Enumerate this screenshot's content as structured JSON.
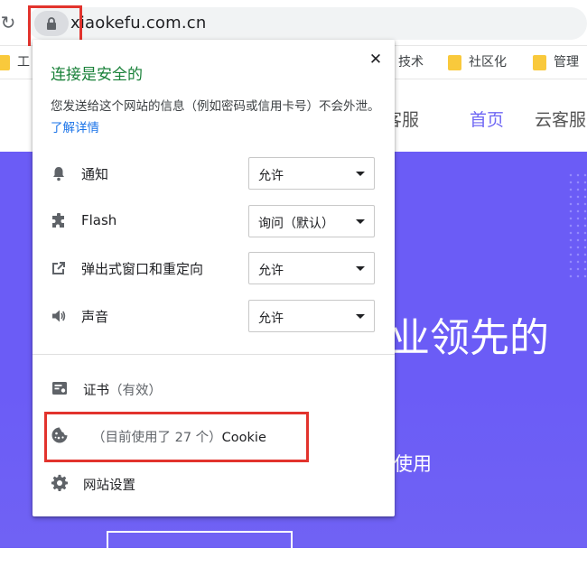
{
  "browser": {
    "url": "xiaokefu.com.cn",
    "bookmarks": [
      "工",
      "技术",
      "社区化",
      "管理"
    ]
  },
  "site": {
    "nav": [
      "客服",
      "首页",
      "云客服"
    ],
    "hero_title": "业领先的",
    "hero_subtitle": "使用"
  },
  "popup": {
    "title": "连接是安全的",
    "close": "✕",
    "description": "您发送给这个网站的信息（例如密码或信用卡号）不会外泄。",
    "learn_more": "了解详情",
    "permissions": [
      {
        "icon": "bell-icon",
        "label": "通知",
        "value": "允许"
      },
      {
        "icon": "puzzle-icon",
        "label": "Flash",
        "value": "询问（默认）"
      },
      {
        "icon": "popup-redirect-icon",
        "label": "弹出式窗口和重定向",
        "value": "允许"
      },
      {
        "icon": "speaker-icon",
        "label": "声音",
        "value": "允许"
      }
    ],
    "certificate": {
      "label": "证书",
      "status": "（有效）"
    },
    "cookies": {
      "prefix": "（目前使用了 27 个）",
      "label": "Cookie"
    },
    "site_settings": "网站设置"
  },
  "colors": {
    "secure_green": "#188038",
    "link_blue": "#1a73e8",
    "hero_purple": "#6b5cf6",
    "highlight_red": "#e2332d"
  }
}
